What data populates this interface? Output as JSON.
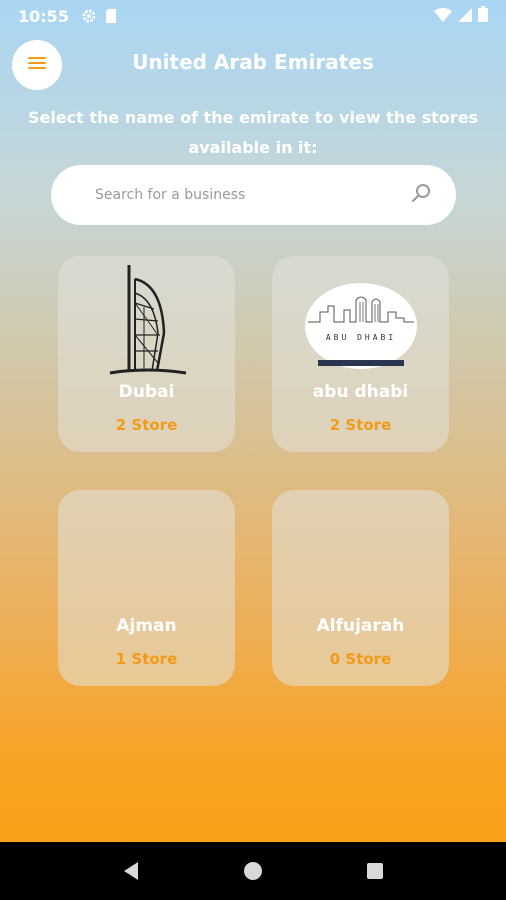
{
  "status_bar": {
    "time": "10:55",
    "icons": [
      "gear-icon",
      "sim-card-icon",
      "wifi-icon",
      "signal-icon",
      "battery-icon"
    ]
  },
  "header": {
    "menu_icon": "hamburger-menu-icon",
    "title": "United Arab Emirates",
    "subtitle": "Select the name of the emirate to view the stores available in it:"
  },
  "search": {
    "placeholder": "Search for a business",
    "icon": "search-icon"
  },
  "emirates": [
    {
      "name": "Dubai",
      "stores": "2 Store",
      "image": "burj-al-arab-icon"
    },
    {
      "name": "abu dhabi",
      "stores": "2 Store",
      "image": "abu-dhabi-logo",
      "image_text": "ABU DHABI"
    },
    {
      "name": "Ajman",
      "stores": "1 Store"
    },
    {
      "name": "Alfujarah",
      "stores": "0 Store"
    }
  ],
  "nav_bar": {
    "icons": [
      "back-icon",
      "home-icon",
      "recents-icon"
    ]
  },
  "colors": {
    "accent": "#f39a16",
    "gradient_top": "#a9d6f4",
    "gradient_bottom": "#fb9d12",
    "nav_bg": "#000000"
  }
}
